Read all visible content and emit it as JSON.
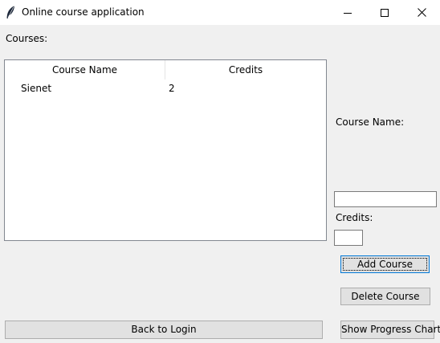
{
  "window": {
    "title": "Online course application",
    "icons": {
      "app": "feather-icon",
      "minimize": "minimize-icon",
      "maximize": "maximize-icon",
      "close": "close-icon"
    }
  },
  "courses": {
    "label": "Courses:",
    "columns": [
      "Course Name",
      "Credits"
    ],
    "rows": [
      {
        "name": "Sienet",
        "credits": "2"
      }
    ]
  },
  "form": {
    "course_name_label": "Course Name:",
    "course_name_value": "",
    "credits_label": "Credits:",
    "credits_value": ""
  },
  "buttons": {
    "add": "Add Course",
    "delete": "Delete Course",
    "back": "Back to Login",
    "chart": "Show Progress Chart"
  },
  "colors": {
    "background": "#f0f0f0",
    "button": "#e1e1e1",
    "focus_border": "#0078d7"
  }
}
